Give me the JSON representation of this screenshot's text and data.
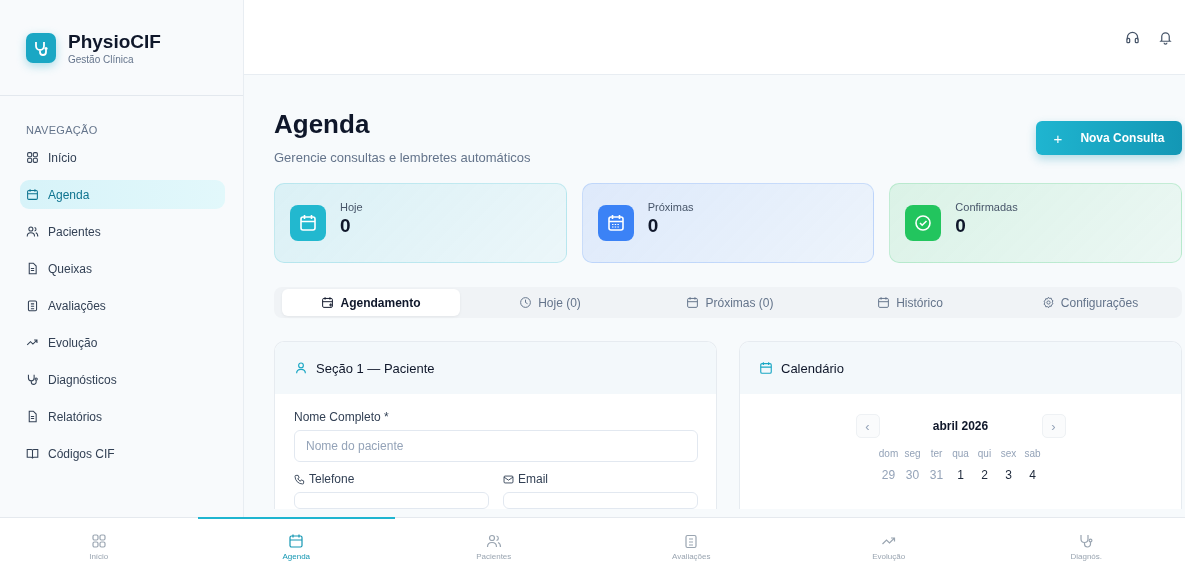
{
  "brand": {
    "name": "PhysioCIF",
    "subtitle": "Gestão Clínica"
  },
  "sidebar": {
    "section_label": "NAVEGAÇÃO",
    "items": [
      {
        "label": "Início",
        "selected": false
      },
      {
        "label": "Agenda",
        "selected": true
      },
      {
        "label": "Pacientes",
        "selected": false
      },
      {
        "label": "Queixas",
        "selected": false
      },
      {
        "label": "Avaliações",
        "selected": false
      },
      {
        "label": "Evolução",
        "selected": false
      },
      {
        "label": "Diagnósticos",
        "selected": false
      },
      {
        "label": "Relatórios",
        "selected": false
      },
      {
        "label": "Códigos CIF",
        "selected": false
      }
    ]
  },
  "page": {
    "title": "Agenda",
    "subtitle": "Gerencie consultas e lembretes automáticos",
    "primary_button": {
      "icon": "+",
      "label": "Nova Consulta"
    }
  },
  "stats": [
    {
      "label": "Hoje",
      "value": "0",
      "color": "#22b8cf"
    },
    {
      "label": "Próximas",
      "value": "0",
      "color": "#3b82f6"
    },
    {
      "label": "Confirmadas",
      "value": "0",
      "color": "#22c55e"
    }
  ],
  "tabs": [
    {
      "label": "Agendamento",
      "selected": true
    },
    {
      "label": "Hoje (0)",
      "selected": false
    },
    {
      "label": "Próximas (0)",
      "selected": false
    },
    {
      "label": "Histórico",
      "selected": false
    },
    {
      "label": "Configurações",
      "selected": false
    }
  ],
  "patient_section": {
    "title": "Seção 1 — Paciente",
    "name_label": "Nome Completo *",
    "name_placeholder": "Nome do paciente",
    "phone_label": "Telefone",
    "email_label": "Email"
  },
  "calendar": {
    "title": "Calendário",
    "prev": "‹",
    "next": "›",
    "month": "abril 2026",
    "weekdays": [
      "dom",
      "seg",
      "ter",
      "qua",
      "qui",
      "sex",
      "sab"
    ],
    "days": [
      {
        "label": "29",
        "outside": true
      },
      {
        "label": "30",
        "outside": true
      },
      {
        "label": "31",
        "outside": true
      },
      {
        "label": "1",
        "outside": false
      },
      {
        "label": "2",
        "outside": false
      },
      {
        "label": "3",
        "outside": false
      },
      {
        "label": "4",
        "outside": false
      }
    ]
  },
  "bottom_nav": [
    {
      "label": "Início",
      "selected": false
    },
    {
      "label": "Agenda",
      "selected": true
    },
    {
      "label": "Pacientes",
      "selected": false
    },
    {
      "label": "Avaliações",
      "selected": false
    },
    {
      "label": "Evolução",
      "selected": false
    },
    {
      "label": "Diagnós.",
      "selected": false
    }
  ]
}
